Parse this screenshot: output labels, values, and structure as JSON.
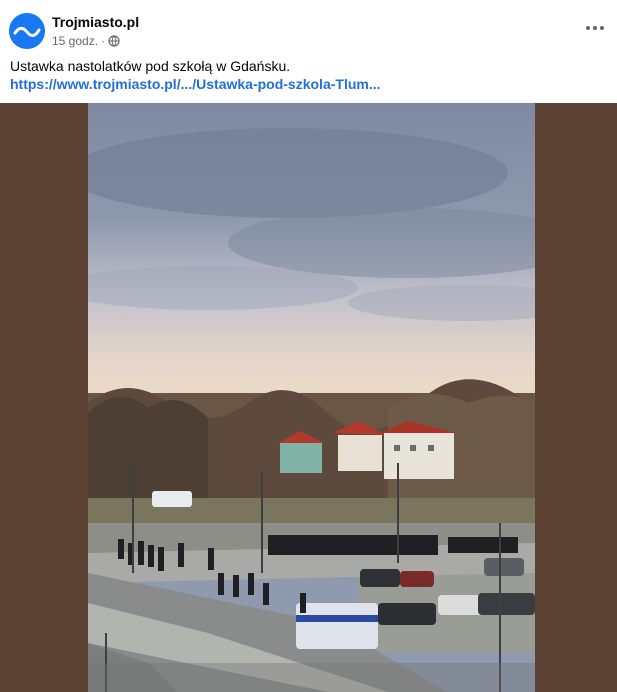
{
  "post": {
    "page_name": "Trojmiasto.pl",
    "time": "15 godz.",
    "separator": "·",
    "text": "Ustawka nastolatków pod szkołą w Gdańsku.",
    "link": "https://www.trojmiasto.pl/.../Ustawka-pod-szkola-Tlum..."
  },
  "icons": {
    "avatar": "trojmiasto-logo",
    "audience": "globe-icon",
    "menu": "more-options-icon"
  },
  "colors": {
    "avatar_bg": "#1877f2",
    "link": "#216fdb",
    "video_side": "#5b4233",
    "meta_text": "#65676b"
  }
}
